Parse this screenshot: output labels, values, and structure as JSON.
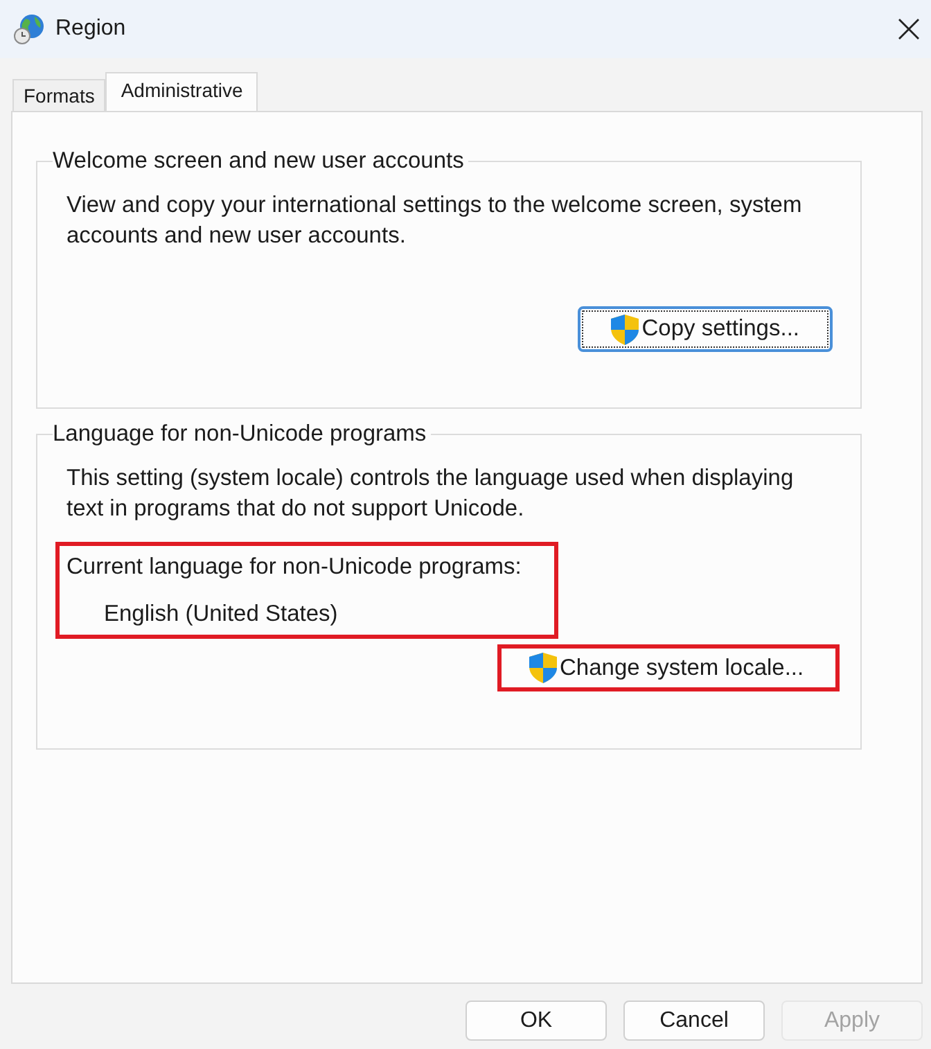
{
  "window": {
    "title": "Region"
  },
  "tabs": [
    {
      "label": "Formats",
      "selected": false
    },
    {
      "label": "Administrative",
      "selected": true
    }
  ],
  "groups": [
    {
      "title": "Welcome screen and new user accounts",
      "description": "View and copy your international settings to the welcome screen, system accounts and new user accounts.",
      "button": {
        "label": "Copy settings...",
        "shield": true,
        "focused": true,
        "highlighted": false
      }
    },
    {
      "title": "Language for non-Unicode programs",
      "description": "This setting (system locale) controls the language used when displaying text in programs that do not support Unicode.",
      "current": {
        "label": "Current language for non-Unicode programs:",
        "value": "English (United States)",
        "highlighted": true
      },
      "button": {
        "label": "Change system locale...",
        "shield": true,
        "focused": false,
        "highlighted": true
      }
    }
  ],
  "buttons": [
    {
      "label": "OK",
      "disabled": false
    },
    {
      "label": "Cancel",
      "disabled": false
    },
    {
      "label": "Apply",
      "disabled": true
    }
  ]
}
